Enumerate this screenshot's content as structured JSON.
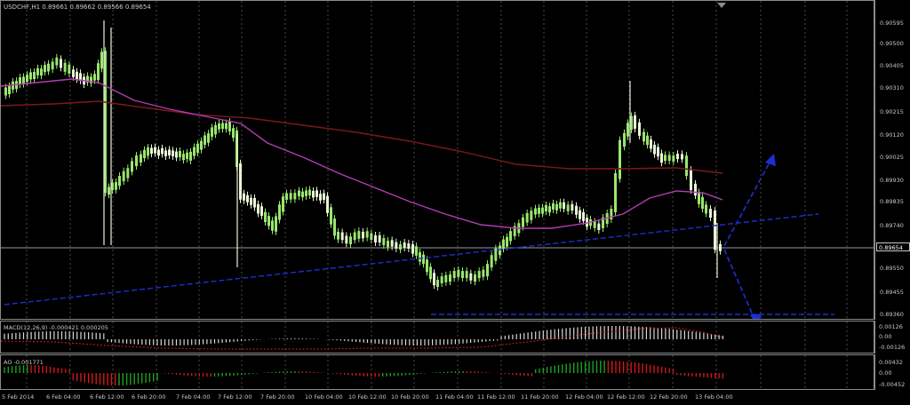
{
  "main": {
    "title": "USDCHF,H1  0.89661 0.89662 0.89566 0.89654",
    "price_labels": [
      "0.90595",
      "0.90500",
      "0.90405",
      "0.90310",
      "0.90215",
      "0.90120",
      "0.90025",
      "0.89930",
      "0.89835",
      "0.89740",
      "0.89654",
      "0.89550",
      "0.89455",
      "0.89360"
    ],
    "current_price": "0.89654"
  },
  "macd": {
    "label": "MACD(12,26,9) -0.000421 0.000205",
    "scale": [
      "0.00126",
      "0.00",
      "-0.00126"
    ]
  },
  "ao": {
    "label": "AO -0.001771",
    "scale": [
      "0.00432",
      "0.00",
      "-0.00452"
    ]
  },
  "time_labels": [
    "5 Feb 2014",
    "6 Feb 04:00",
    "6 Feb 12:00",
    "6 Feb 20:00",
    "7 Feb 04:00",
    "7 Feb 12:00",
    "7 Feb 20:00",
    "10 Feb 04:00",
    "10 Feb 12:00",
    "10 Feb 20:00",
    "11 Feb 04:00",
    "11 Feb 12:00",
    "11 Feb 20:00",
    "12 Feb 04:00",
    "12 Feb 12:00",
    "12 Feb 20:00",
    "13 Feb 04:00"
  ],
  "colors": {
    "background": "#000000",
    "bull_candle": "#9ae66e",
    "bear_candle": "#e8f5d8",
    "ma_fast": "#b43cb4",
    "ma_slow": "#7a1a1a",
    "trendline": "#1e2fd0",
    "grid": "#6a6a6a",
    "current_price_line": "#9a9a9a"
  }
}
